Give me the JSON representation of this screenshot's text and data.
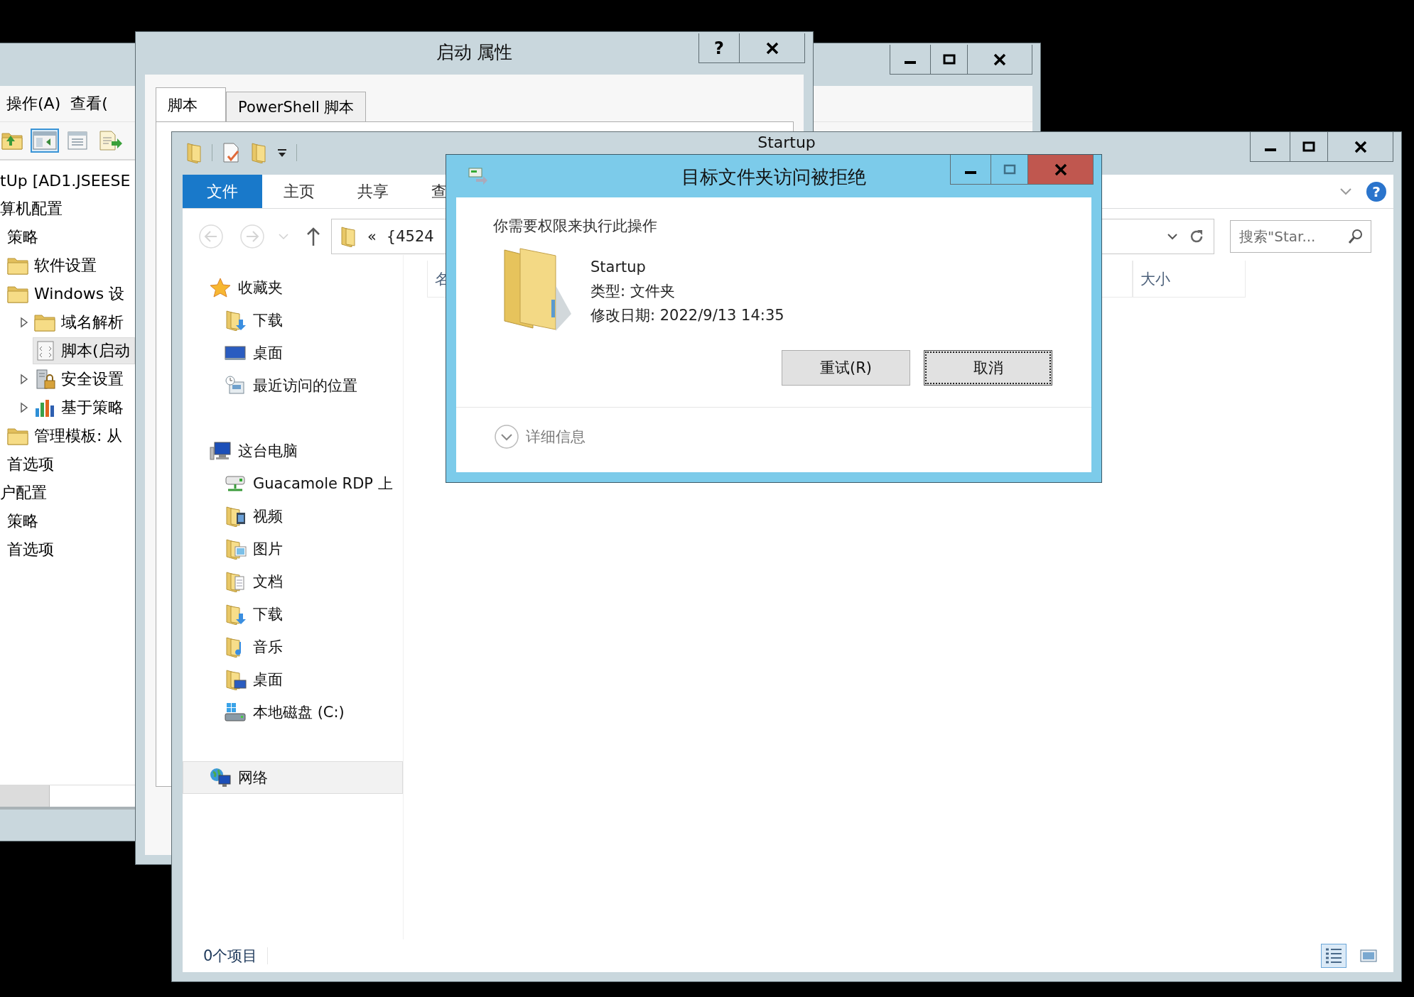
{
  "policy_window": {
    "menu": [
      "操作(A)",
      "查看("
    ],
    "toolbar": [
      {
        "kind": "folder-up",
        "selected": false
      },
      {
        "kind": "pane",
        "selected": true
      },
      {
        "kind": "sheet",
        "selected": false
      },
      {
        "kind": "export",
        "selected": false
      }
    ],
    "tree": [
      {
        "label": "tUp [AD1.JSEESE",
        "kind": "text",
        "selected": false,
        "collapsed": false,
        "children": [
          {
            "label": "算机配置",
            "kind": "text",
            "selected": false,
            "collapsed": false,
            "children": [
              {
                "label": "策略",
                "kind": "text",
                "selected": false,
                "collapsed": false,
                "children": [
                  {
                    "label": "软件设置",
                    "kind": "folder",
                    "selected": false,
                    "collapsed": false
                  },
                  {
                    "label": "Windows 设",
                    "kind": "folder",
                    "selected": false,
                    "collapsed": false,
                    "children": [
                      {
                        "label": "域名解析",
                        "kind": "folder",
                        "selected": false,
                        "collapsed": true
                      },
                      {
                        "label": "脚本(启动",
                        "kind": "script",
                        "selected": true,
                        "collapsed": false
                      },
                      {
                        "label": "安全设置",
                        "kind": "lock",
                        "selected": false,
                        "collapsed": true
                      },
                      {
                        "label": "基于策略",
                        "kind": "chart",
                        "selected": false,
                        "collapsed": true
                      }
                    ]
                  },
                  {
                    "label": "管理模板: 从",
                    "kind": "folder",
                    "selected": false,
                    "collapsed": false
                  }
                ]
              },
              {
                "label": "首选项",
                "kind": "text",
                "selected": false,
                "collapsed": false
              }
            ]
          },
          {
            "label": "户配置",
            "kind": "text",
            "selected": false,
            "collapsed": false,
            "children": [
              {
                "label": "策略",
                "kind": "text",
                "selected": false,
                "collapsed": false
              },
              {
                "label": "首选项",
                "kind": "text",
                "selected": false,
                "collapsed": false
              }
            ]
          }
        ]
      }
    ]
  },
  "properties_window": {
    "title": "启动 属性",
    "help": "?",
    "tabs": [
      {
        "label": "脚本",
        "selected": true
      },
      {
        "label": "PowerShell 脚本",
        "selected": false
      }
    ]
  },
  "explorer": {
    "title": "Startup",
    "ribbon_tabs": [
      {
        "label": "文件",
        "selected": true
      },
      {
        "label": "主页",
        "selected": false
      },
      {
        "label": "共享",
        "selected": false
      },
      {
        "label": "查",
        "selected": false
      }
    ],
    "help": "?",
    "address": {
      "prefix": "«",
      "path": "{4524"
    },
    "search": {
      "placeholder": "搜索\"Star..."
    },
    "navigation": [
      {
        "label": "收藏夹",
        "kind": "star",
        "selected": false,
        "children": [
          {
            "label": "下载",
            "kind": "downloads",
            "selected": false
          },
          {
            "label": "桌面",
            "kind": "desktop",
            "selected": false
          },
          {
            "label": "最近访问的位置",
            "kind": "recent",
            "selected": false
          }
        ]
      },
      {
        "label": "这台电脑",
        "kind": "computer",
        "selected": false,
        "children": [
          {
            "label": "Guacamole RDP 上",
            "kind": "network-drive",
            "selected": false
          },
          {
            "label": "视频",
            "kind": "video",
            "selected": false
          },
          {
            "label": "图片",
            "kind": "pictures",
            "selected": false
          },
          {
            "label": "文档",
            "kind": "documents",
            "selected": false
          },
          {
            "label": "下载",
            "kind": "downloads",
            "selected": false
          },
          {
            "label": "音乐",
            "kind": "music",
            "selected": false
          },
          {
            "label": "桌面",
            "kind": "desktop-folder",
            "selected": false
          },
          {
            "label": "本地磁盘 (C:)",
            "kind": "disk",
            "selected": false
          }
        ]
      },
      {
        "label": "网络",
        "kind": "network",
        "selected": true
      }
    ],
    "columns": [
      "名",
      "大小"
    ],
    "status": "0个项目",
    "views": [
      {
        "kind": "details",
        "selected": true
      },
      {
        "kind": "tiles",
        "selected": false
      }
    ]
  },
  "dialog": {
    "title": "目标文件夹访问被拒绝",
    "message": "你需要权限来执行此操作",
    "item": {
      "name": "Startup",
      "type": "类型: 文件夹",
      "modified": "修改日期: 2022/9/13 14:35"
    },
    "buttons": [
      {
        "label": "重试(R)",
        "focused": false
      },
      {
        "label": "取消",
        "focused": true
      }
    ],
    "details": "详细信息"
  }
}
